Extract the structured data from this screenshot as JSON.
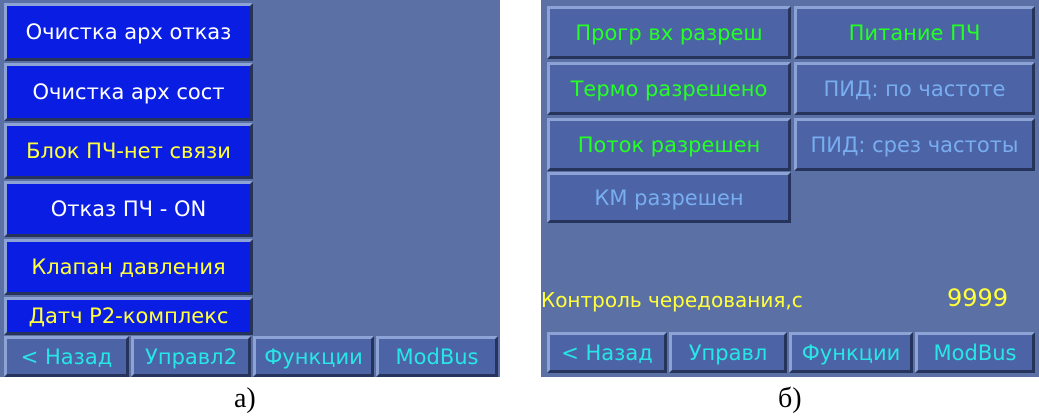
{
  "panel_a": {
    "buttons": [
      "Очистка арх отказ",
      "Очистка арх сост",
      "Блок ПЧ-нет связи",
      "Отказ ПЧ - ON",
      "Клапан давления",
      "Датч Р2-комплекс"
    ],
    "nav": [
      "< Назад",
      "Управл2",
      "Функции",
      "ModBus"
    ],
    "caption": "а)"
  },
  "panel_b": {
    "buttons_left": [
      "Прогр вх разреш",
      "Термо разрешено",
      "Поток разрешен",
      "КМ разрешен"
    ],
    "buttons_right": [
      "Питание ПЧ",
      "ПИД: по частоте",
      "ПИД: срез частоты"
    ],
    "control_label": "Контроль чередования,с",
    "control_value": "9999",
    "nav": [
      "< Назад",
      "Управл",
      "Функции",
      "ModBus"
    ],
    "caption": "б)"
  },
  "colors": {
    "screen_bg": "#5b70a5",
    "button_blue": "#0a1ee3",
    "button_steel": "#4c63a6",
    "text_green": "#24ff24",
    "text_yellow": "#ffff3b",
    "text_cyan": "#28e6e6"
  }
}
